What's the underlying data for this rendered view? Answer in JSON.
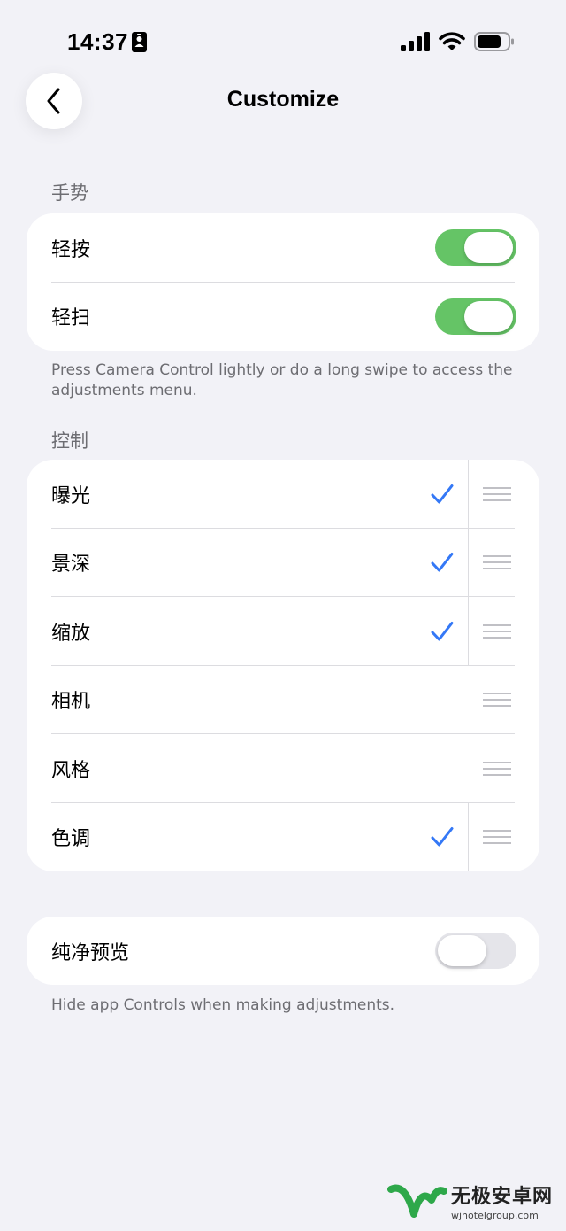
{
  "status_bar": {
    "time": "14:37",
    "icons": [
      "id-icon",
      "signal-icon",
      "wifi-icon",
      "battery-icon"
    ]
  },
  "header": {
    "title": "Customize",
    "back_icon": "chevron-left-icon"
  },
  "gestures": {
    "header": "手势",
    "rows": [
      {
        "label": "轻按",
        "toggle_on": true
      },
      {
        "label": "轻扫",
        "toggle_on": true
      }
    ],
    "footer": "Press Camera Control lightly or do a long swipe to access the adjustments menu."
  },
  "controls": {
    "header": "控制",
    "rows": [
      {
        "label": "曝光",
        "checked": true
      },
      {
        "label": "景深",
        "checked": true
      },
      {
        "label": "缩放",
        "checked": true
      },
      {
        "label": "相机",
        "checked": false
      },
      {
        "label": "风格",
        "checked": false
      },
      {
        "label": "色调",
        "checked": true
      }
    ]
  },
  "clean_preview": {
    "label": "纯净预览",
    "toggle_on": false,
    "footer": "Hide app Controls when making adjustments."
  },
  "watermark": {
    "title": "无极安卓网",
    "url": "wjhotelgroup.com"
  },
  "colors": {
    "accent": "#3478f6",
    "toggle_on": "#65c466",
    "background": "#f2f2f7"
  }
}
